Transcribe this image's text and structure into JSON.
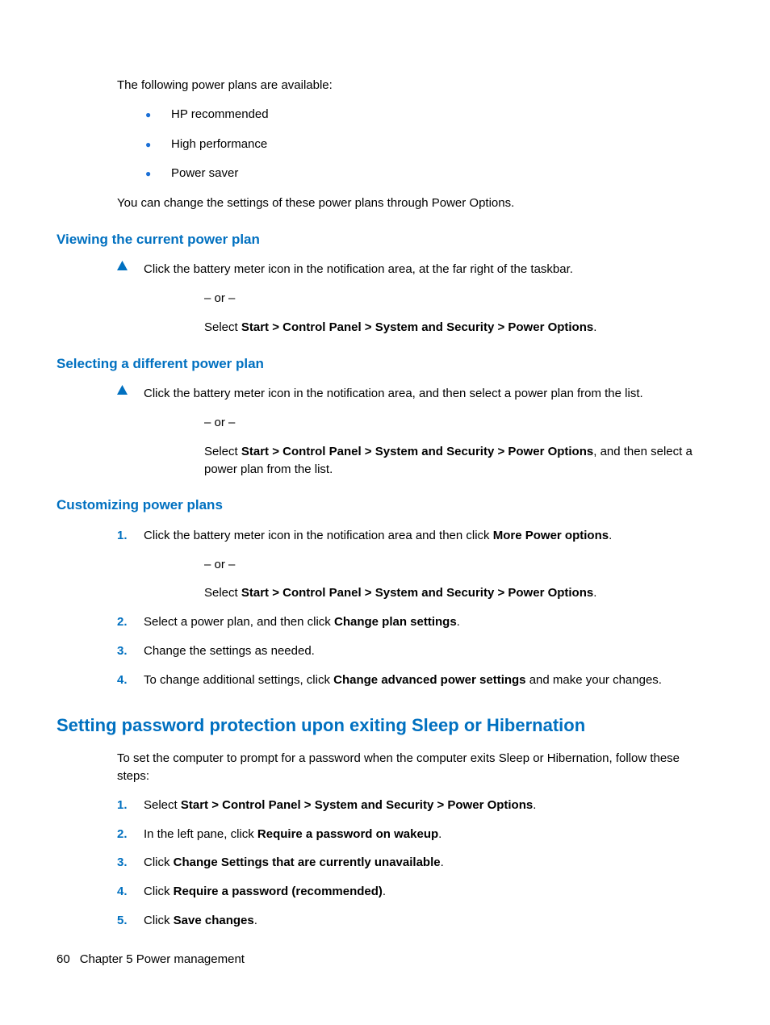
{
  "intro": "The following power plans are available:",
  "plans": [
    "HP recommended",
    "High performance",
    "Power saver"
  ],
  "afterPlans": "You can change the settings of these power plans through Power Options.",
  "sec1": {
    "title": "Viewing the current power plan",
    "step1": "Click the battery meter icon in the notification area, at the far right of the taskbar.",
    "or": "– or –",
    "sel1": "Select ",
    "nav": "Start > Control Panel > System and Security > Power Options",
    "period": "."
  },
  "sec2": {
    "title": "Selecting a different power plan",
    "step1": "Click the battery meter icon in the notification area, and then select a power plan from the list.",
    "or": "– or –",
    "sel1": "Select ",
    "nav": "Start > Control Panel > System and Security > Power Options",
    "tail": ", and then select a power plan from the list."
  },
  "sec3": {
    "title": "Customizing power plans",
    "s1a": "Click the battery meter icon in the notification area and then click ",
    "s1b": "More Power options",
    "or": "– or –",
    "s1c": "Select ",
    "s1d": "Start > Control Panel > System and Security > Power Options",
    "s2a": "Select a power plan, and then click ",
    "s2b": "Change plan settings",
    "s3": "Change the settings as needed.",
    "s4a": "To change additional settings, click ",
    "s4b": "Change advanced power settings",
    "s4c": " and make your changes."
  },
  "sec4": {
    "title": "Setting password protection upon exiting Sleep or Hibernation",
    "intro": "To set the computer to prompt for a password when the computer exits Sleep or Hibernation, follow these steps:",
    "s1a": "Select ",
    "s1b": "Start > Control Panel > System and Security > Power Options",
    "s2a": "In the left pane, click ",
    "s2b": "Require a password on wakeup",
    "s3a": "Click ",
    "s3b": "Change Settings that are currently unavailable",
    "s4a": "Click ",
    "s4b": "Require a password (recommended)",
    "s5a": "Click ",
    "s5b": "Save changes"
  },
  "footer": {
    "page": "60",
    "chapter": "Chapter 5   Power management"
  },
  "nums": {
    "n1": "1.",
    "n2": "2.",
    "n3": "3.",
    "n4": "4.",
    "n5": "5."
  },
  "period": "."
}
